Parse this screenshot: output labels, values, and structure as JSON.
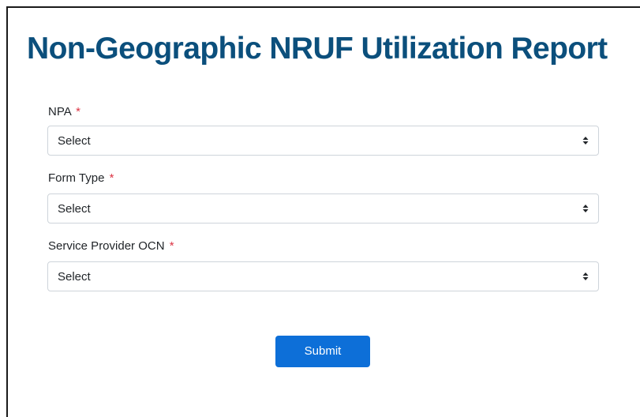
{
  "page": {
    "title": "Non-Geographic NRUF Utilization Report"
  },
  "form": {
    "required_marker": "*",
    "fields": [
      {
        "label": "NPA",
        "value": "Select",
        "caret_icon": "updown-caret-icon"
      },
      {
        "label": "Form Type",
        "value": "Select",
        "caret_icon": "updown-caret-icon"
      },
      {
        "label": "Service Provider OCN",
        "value": "Select",
        "caret_icon": "updown-caret-icon"
      }
    ],
    "submit_label": "Submit"
  },
  "colors": {
    "title": "#0b4f7c",
    "required": "#dc3545",
    "submit_bg": "#0d6fd8",
    "border": "#ced4da"
  }
}
